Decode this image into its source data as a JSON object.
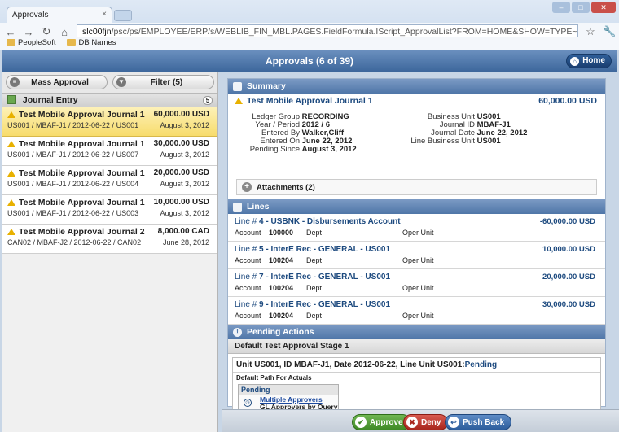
{
  "browser": {
    "tab_title": "Approvals",
    "tab_close": "×",
    "url_prefix": "slc00fjn",
    "url_rest": "/psc/ps/EMPLOYEE/ERP/s/WEBLIB_FIN_MBL.PAGES.FieldFormula.IScript_ApprovalList?FROM=HOME&SHOW=TYPE~GLJE",
    "bookmarks": [
      "PeopleSoft",
      "DB Names"
    ]
  },
  "appbar": {
    "title": "Approvals (6 of 39)",
    "home_label": "Home"
  },
  "left": {
    "mass_approval_label": "Mass Approval",
    "filter_label": "Filter (5)",
    "section_title": "Journal Entry",
    "section_count": "5",
    "items": [
      {
        "title": "Test Mobile Approval Journal 1",
        "sub": "US001 / MBAF-J1 / 2012-06-22 / US001",
        "amount": "60,000.00 USD",
        "date": "August 3, 2012",
        "selected": true
      },
      {
        "title": "Test Mobile Approval Journal 1",
        "sub": "US001 / MBAF-J1 / 2012-06-22 / US007",
        "amount": "30,000.00 USD",
        "date": "August 3, 2012"
      },
      {
        "title": "Test Mobile Approval Journal 1",
        "sub": "US001 / MBAF-J1 / 2012-06-22 / US004",
        "amount": "20,000.00 USD",
        "date": "August 3, 2012"
      },
      {
        "title": "Test Mobile Approval Journal 1",
        "sub": "US001 / MBAF-J1 / 2012-06-22 / US003",
        "amount": "10,000.00 USD",
        "date": "August 3, 2012"
      },
      {
        "title": "Test Mobile Approval Journal 2",
        "sub": "CAN02 / MBAF-J2 / 2012-06-22 / CAN02",
        "amount": "8,000.00 CAD",
        "date": "June 28, 2012"
      }
    ]
  },
  "summary": {
    "header": "Summary",
    "title": "Test Mobile Approval Journal 1",
    "amount": "60,000.00 USD",
    "left_fields": [
      {
        "k": "Ledger Group",
        "v": "RECORDING"
      },
      {
        "k": "Year / Period",
        "v": "2012 / 6"
      },
      {
        "k": "Entered By",
        "v": "Walker,Cliff"
      },
      {
        "k": "Entered On",
        "v": "June 22, 2012"
      },
      {
        "k": "Pending Since",
        "v": "August 3, 2012"
      }
    ],
    "right_fields": [
      {
        "k": "Business Unit",
        "v": "US001"
      },
      {
        "k": "Journal ID",
        "v": "MBAF-J1"
      },
      {
        "k": "Journal Date",
        "v": "June 22, 2012"
      },
      {
        "k": "Line Business Unit",
        "v": "US001"
      }
    ],
    "attachments_label": "Attachments (2)"
  },
  "lines": {
    "header": "Lines",
    "items": [
      {
        "prefix": "Line # ",
        "num": "4",
        "desc": " - USBNK - Disbursements Account",
        "amount": "-60,000.00 USD",
        "account_label": "Account",
        "account": "100000",
        "dept_label": "Dept",
        "oper_label": "Oper Unit"
      },
      {
        "prefix": "Line # ",
        "num": "5",
        "desc": " - InterE Rec - GENERAL - US001",
        "amount": "10,000.00 USD",
        "account_label": "Account",
        "account": "100204",
        "dept_label": "Dept",
        "oper_label": "Oper Unit"
      },
      {
        "prefix": "Line # ",
        "num": "7",
        "desc": " - InterE Rec - GENERAL - US001",
        "amount": "20,000.00 USD",
        "account_label": "Account",
        "account": "100204",
        "dept_label": "Dept",
        "oper_label": "Oper Unit"
      },
      {
        "prefix": "Line # ",
        "num": "9",
        "desc": " - InterE Rec - GENERAL - US001",
        "amount": "30,000.00 USD",
        "account_label": "Account",
        "account": "100204",
        "dept_label": "Dept",
        "oper_label": "Oper Unit"
      }
    ]
  },
  "pending": {
    "header": "Pending Actions",
    "stage": "Default Test Approval Stage 1",
    "unit_text": "Unit US001, ID MBAF-J1, Date 2012-06-22, Line Unit US001:",
    "unit_status": "Pending",
    "path": "Default Path For Actuals",
    "box_title": "Pending",
    "approvers_link": "Multiple Approvers",
    "approvers_query": "GL Approvers by Query"
  },
  "footer": {
    "approve": "Approve",
    "deny": "Deny",
    "pushback": "Push Back"
  },
  "colors": {
    "accent": "#3d679c",
    "selected": "#f7dc6c",
    "approve": "#3f8a26",
    "deny": "#a8261d",
    "pushback": "#2d5d9c"
  }
}
